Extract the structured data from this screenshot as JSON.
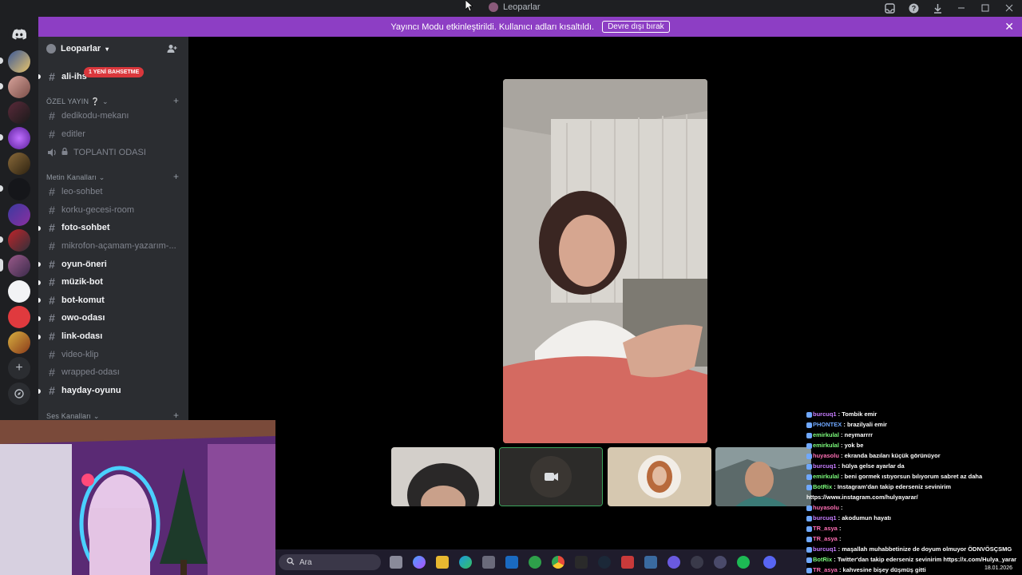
{
  "window": {
    "title": "Leoparlar"
  },
  "banner": {
    "text": "Yayıncı Modu etkinleştirildi. Kullanıcı adları kısaltıldı.",
    "button": "Devre dışı bırak"
  },
  "guild": {
    "name": "Leoparlar"
  },
  "mention_badge": "1 YENİ BAHSETME",
  "categories": {
    "ozel": "ÖZEL YAYIN",
    "metin": "Metin Kanalları",
    "ses": "Ses Kanalları"
  },
  "channels": [
    {
      "name": "ali-ihs",
      "unread": true
    },
    {
      "name": "dedikodu-mekanı",
      "unread": false
    },
    {
      "name": "editler",
      "unread": false
    },
    {
      "name": "TOPLANTI ODASI",
      "unread": false
    },
    {
      "name": "leo-sohbet",
      "unread": false
    },
    {
      "name": "korku-gecesi-room",
      "unread": false
    },
    {
      "name": "foto-sohbet",
      "unread": true
    },
    {
      "name": "mikrofon-açamam-yazarım-...",
      "unread": false
    },
    {
      "name": "oyun-öneri",
      "unread": true
    },
    {
      "name": "müzik-bot",
      "unread": true
    },
    {
      "name": "bot-komut",
      "unread": true
    },
    {
      "name": "owo-odası",
      "unread": true
    },
    {
      "name": "link-odası",
      "unread": true
    },
    {
      "name": "video-klip",
      "unread": false
    },
    {
      "name": "wrapped-odası",
      "unread": false
    },
    {
      "name": "hayday-oyunu",
      "unread": true
    }
  ],
  "taskbar": {
    "search_placeholder": "Ara"
  },
  "chat": [
    {
      "user": "burcuq1",
      "color": "#c77dff",
      "msg": "Tombik emir"
    },
    {
      "user": "PHONTEX",
      "color": "#6fa8ff",
      "msg": "brazilyali emir"
    },
    {
      "user": "emirkulal",
      "color": "#7cfc7c",
      "msg": "neymarrrr"
    },
    {
      "user": "emirkulal",
      "color": "#7cfc7c",
      "msg": "yok be"
    },
    {
      "user": "huyasolu",
      "color": "#ff6fb5",
      "msg": "ekranda bazıları küçük görünüyor"
    },
    {
      "user": "burcuq1",
      "color": "#c77dff",
      "msg": "hülya gelse ayarlar da"
    },
    {
      "user": "emirkulal",
      "color": "#7cfc7c",
      "msg": "beni gormek ıstıyorsun bılıyorum sabret az daha"
    },
    {
      "user": "BotRix",
      "color": "#7cfc7c",
      "msg": "Instagram'dan takip ederseniz sevinirim"
    },
    {
      "user": "",
      "color": "#ffffff",
      "msg": "https://www.instagram.com/hulyayarar/"
    },
    {
      "user": "huyasolu",
      "color": "#ff6fb5",
      "msg": ""
    },
    {
      "user": "burcuq1",
      "color": "#c77dff",
      "msg": "akodumun hayatı"
    },
    {
      "user": "TR_asya",
      "color": "#ff6fb5",
      "msg": ""
    },
    {
      "user": "TR_asya",
      "color": "#ff6fb5",
      "msg": ""
    },
    {
      "user": "burcuq1",
      "color": "#c77dff",
      "msg": "maşallah muhabbetinize de doyum olmuyor ÖDNVÖSÇSMG"
    },
    {
      "user": "BotRix",
      "color": "#7cfc7c",
      "msg": "Twitter'dan takip ederseniz sevinirim https://x.com/Hulya_yarar"
    },
    {
      "user": "TR_asya",
      "color": "#ff6fb5",
      "msg": "kahvesine bişey düşmüş gitti"
    }
  ],
  "clock": {
    "date": "18.01.2026"
  },
  "colors": {
    "banner": "#8d3ec4",
    "mention": "#da373c",
    "rail": "#1e1f22",
    "sidebar": "#2b2d31"
  }
}
